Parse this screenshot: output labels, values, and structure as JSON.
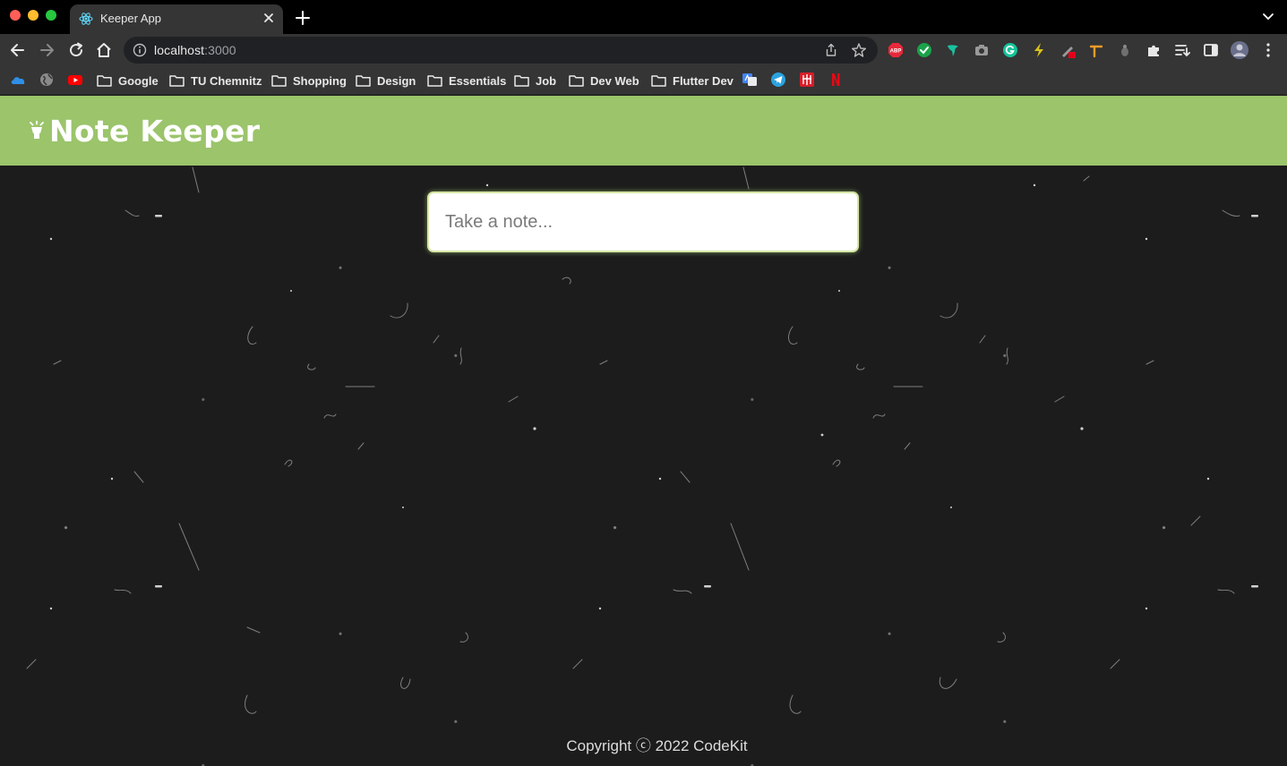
{
  "browser": {
    "tab_title": "Keeper App",
    "url_host": "localhost",
    "url_port": ":3000",
    "bookmarks": [
      "Google",
      "TU Chemnitz",
      "Shopping",
      "Design",
      "Essentials",
      "Job",
      "Dev Web",
      "Flutter Dev"
    ]
  },
  "app": {
    "title": "Note Keeper",
    "note_placeholder": "Take a note...",
    "footer": "Copyright ⓒ 2022 CodeKit",
    "header_color": "#9bc46b",
    "background_color": "#1c1c1c"
  }
}
